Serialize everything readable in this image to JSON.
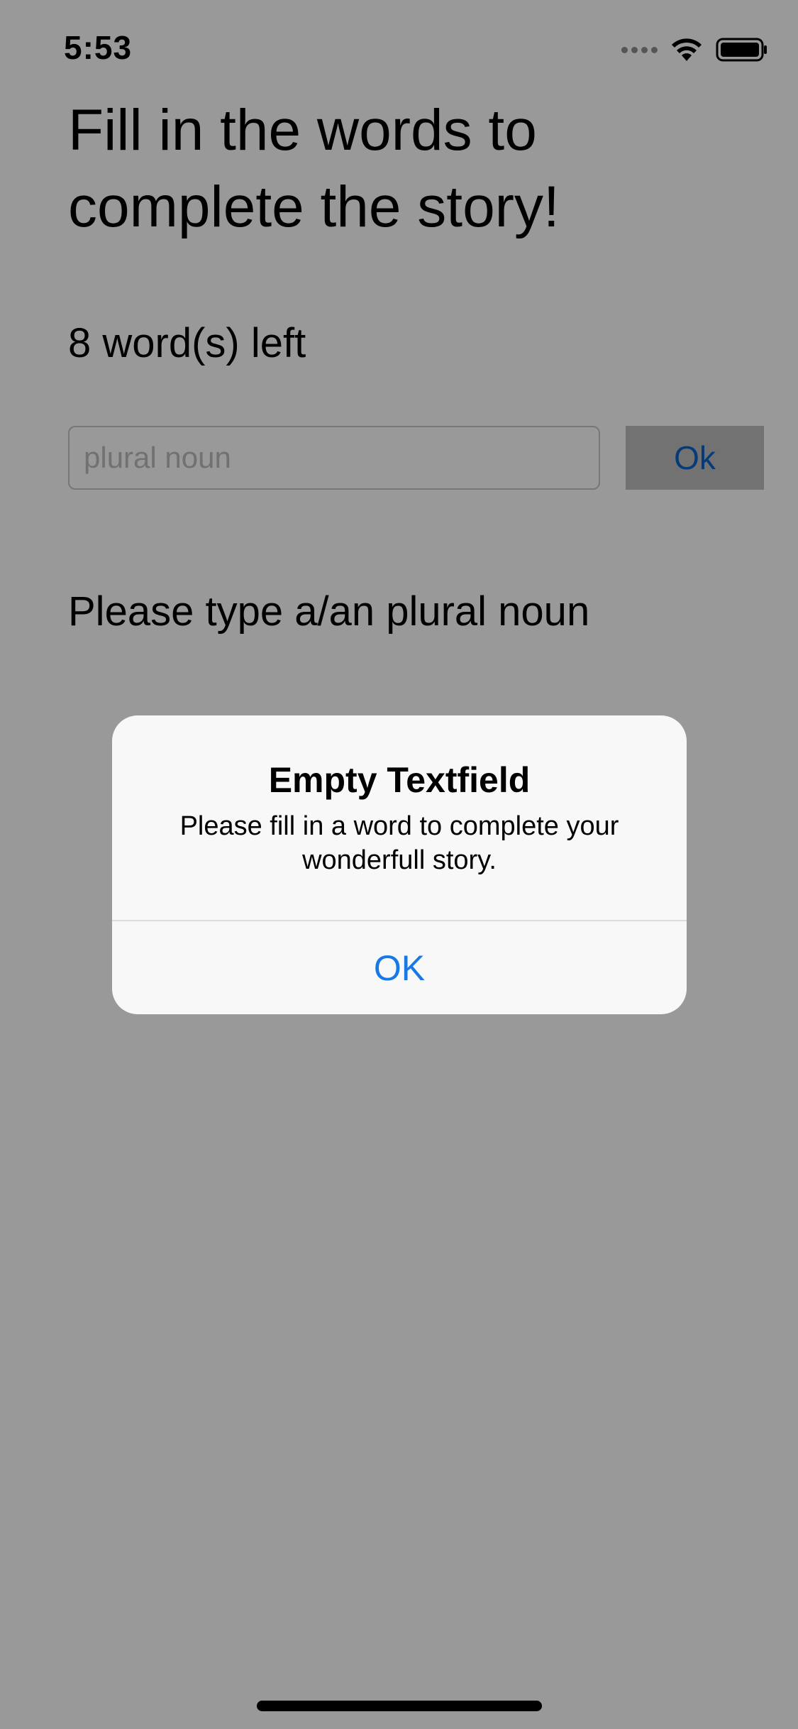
{
  "status_bar": {
    "time": "5:53",
    "signal_icon": "signal-dots-icon",
    "wifi_icon": "wifi-icon",
    "battery_icon": "battery-icon"
  },
  "main": {
    "title": "Fill in the words to complete the story!",
    "words_left": "8 word(s) left",
    "input": {
      "value": "",
      "placeholder": "plural noun"
    },
    "ok_button_label": "Ok",
    "prompt": "Please type a/an plural noun"
  },
  "alert": {
    "title": "Empty Textfield",
    "message": "Please fill in a word to complete your wonderfull story.",
    "ok_label": "OK"
  },
  "colors": {
    "accent": "#1878e6",
    "dim_overlay": "rgba(0,0,0,0.4)",
    "alert_background": "#f8f8f8"
  }
}
